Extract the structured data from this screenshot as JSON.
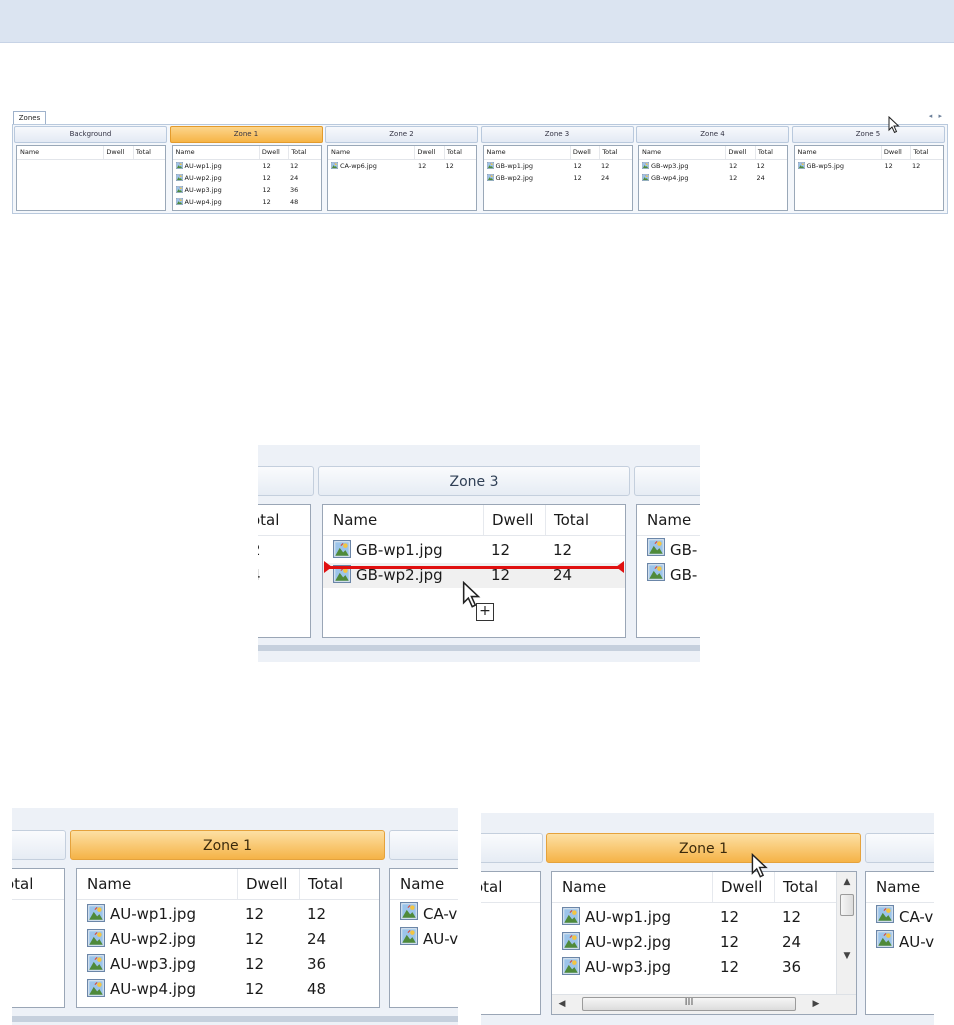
{
  "tab_label": "Zones",
  "scroll_arrows": "◂ ▸",
  "columns": {
    "name": "Name",
    "dwell": "Dwell",
    "total": "Total"
  },
  "zones": [
    {
      "title": "Background",
      "active": false,
      "files": []
    },
    {
      "title": "Zone 1",
      "active": true,
      "files": [
        {
          "name": "AU-wp1.jpg",
          "dwell": "12",
          "total": "12"
        },
        {
          "name": "AU-wp2.jpg",
          "dwell": "12",
          "total": "24"
        },
        {
          "name": "AU-wp3.jpg",
          "dwell": "12",
          "total": "36"
        },
        {
          "name": "AU-wp4.jpg",
          "dwell": "12",
          "total": "48"
        }
      ]
    },
    {
      "title": "Zone 2",
      "active": false,
      "files": [
        {
          "name": "CA-wp6.jpg",
          "dwell": "12",
          "total": "12"
        }
      ]
    },
    {
      "title": "Zone 3",
      "active": false,
      "files": [
        {
          "name": "GB-wp1.jpg",
          "dwell": "12",
          "total": "12"
        },
        {
          "name": "GB-wp2.jpg",
          "dwell": "12",
          "total": "24"
        }
      ]
    },
    {
      "title": "Zone 4",
      "active": false,
      "files": [
        {
          "name": "GB-wp3.jpg",
          "dwell": "12",
          "total": "12"
        },
        {
          "name": "GB-wp4.jpg",
          "dwell": "12",
          "total": "24"
        }
      ]
    },
    {
      "title": "Zone 5",
      "active": false,
      "files": [
        {
          "name": "GB-wp5.jpg",
          "dwell": "12",
          "total": "12"
        }
      ]
    }
  ],
  "zone3_view": {
    "title": "Zone 3",
    "left_partial_header": "otal",
    "left_partial_values": [
      "2",
      "4"
    ],
    "right_partial_header": "Name",
    "right_partial_values": [
      "GB-",
      "GB-"
    ],
    "drop_indicator": "+"
  },
  "zone1_view_a": {
    "title": "Zone 1",
    "left_partial_header": "otal",
    "right_partial_header": "Name",
    "right_partial_values": [
      "CA-v",
      "AU-v"
    ]
  },
  "zone1_view_b": {
    "title": "Zone 1",
    "left_partial_header": "otal",
    "right_partial_header": "Name",
    "right_partial_values": [
      "CA-v",
      "AU-v"
    ],
    "scrollbar_up": "▲",
    "scrollbar_down": "▼",
    "scrollbar_left": "◀",
    "scrollbar_right": "▶",
    "scroll_grip": "III"
  },
  "colors": {
    "active_tab": "#f6b446",
    "drop_indicator": "#e01010",
    "header_bar": "#dbe4f1"
  },
  "icons": [
    "image-file-icon",
    "mouse-cursor-icon",
    "drag-copy-icon"
  ]
}
